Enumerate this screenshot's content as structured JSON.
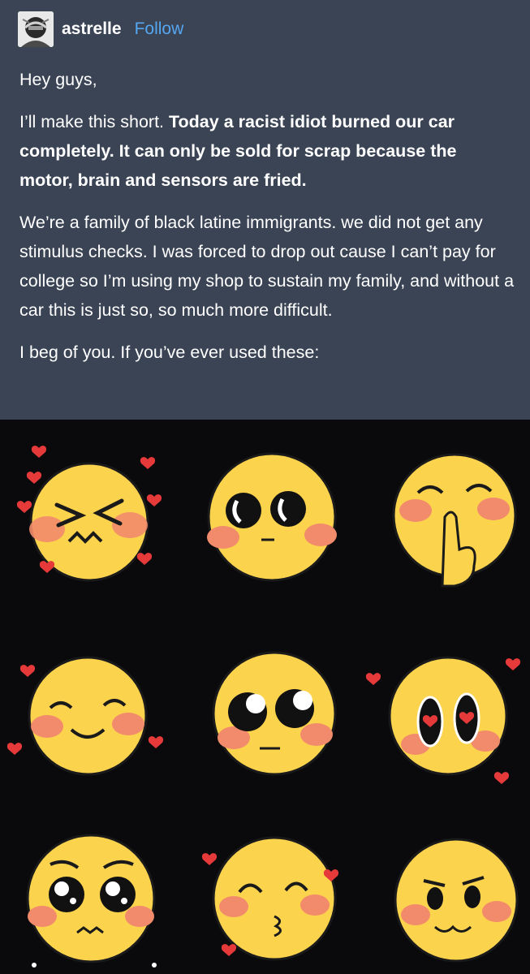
{
  "post": {
    "username": "astrelle",
    "follow_label": "Follow",
    "greeting": "Hey guys,",
    "p1_plain": "I’ll make this short. ",
    "p1_bold": "Today a racist idiot burned our car completely. It can only be sold for scrap because the motor, brain and sensors are fried.",
    "p2": "We’re a family of black latine immigrants. we did not get any stimulus checks. I was forced to drop out cause I can’t pay for college so I’m using my shop to sustain my family, and without a car this is just so, so much more difficult.",
    "p3": "I beg of you. If you’ve ever used these:"
  },
  "colors": {
    "post_bg": "#3b4455",
    "text": "#ffffff",
    "link": "#55a7f1",
    "emoji_bg": "#0a0a0d",
    "emoji_face": "#fcd34d",
    "emoji_blush": "#f28b6c",
    "heart": "#e63a3a"
  },
  "emojis": [
    {
      "name": "squinting-emoji",
      "expression": "squint"
    },
    {
      "name": "wide-eyes-emoji",
      "expression": "wide"
    },
    {
      "name": "shush-emoji",
      "expression": "shush"
    },
    {
      "name": "smile-emoji",
      "expression": "smile"
    },
    {
      "name": "looking-up-emoji",
      "expression": "lookup"
    },
    {
      "name": "heart-eyes-emoji",
      "expression": "hearteyes"
    },
    {
      "name": "teary-emoji",
      "expression": "teary"
    },
    {
      "name": "kiss-emoji",
      "expression": "kiss"
    },
    {
      "name": "smug-emoji",
      "expression": "smug"
    }
  ]
}
